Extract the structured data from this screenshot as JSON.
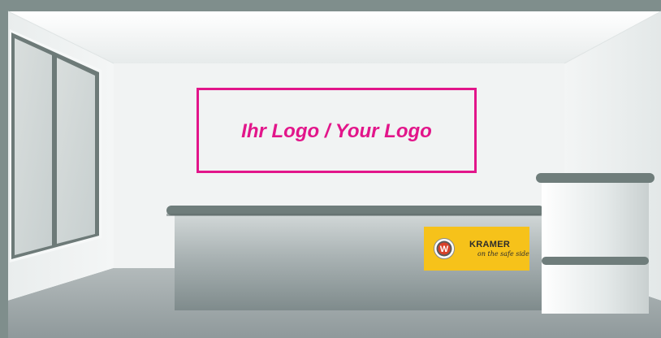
{
  "wall_logo": {
    "text": "Ihr Logo / Your Logo",
    "color": "#e2158a"
  },
  "kramer_sign": {
    "brand": "KRAMER",
    "slogan": "on the safe side",
    "background_color": "#f6c21a",
    "badge_letter": "W"
  },
  "colors": {
    "frame": "#7f8e8c",
    "back_wall": "#f1f3f3",
    "floor": "#9aa3a5",
    "counter_top": "#6f7d7b",
    "counter_front": "#8e9a9c"
  }
}
